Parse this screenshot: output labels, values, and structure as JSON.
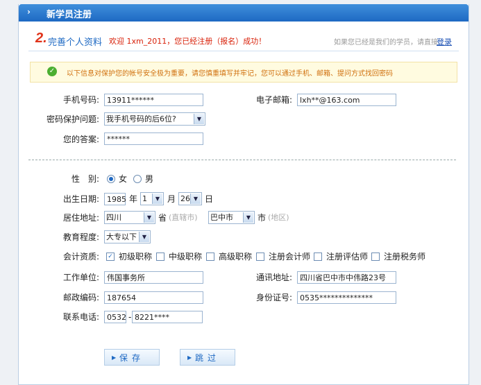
{
  "header": {
    "title": "新学员注册",
    "arrow": "›"
  },
  "step": {
    "number": "2.",
    "label": "完善个人资料"
  },
  "welcome": "欢迎 1xm_2011，您已经注册（报名）成功！",
  "login": {
    "hint": "如果您已经是我们的学员，请直接",
    "link": "登录"
  },
  "notice": "以下信息对保护您的帐号安全极为重要，请您慎重填写并牢记，您可以通过手机、邮箱、提问方式找回密码",
  "security": {
    "phone_label": "手机号码:",
    "phone_value": "13911******",
    "email_label": "电子邮箱:",
    "email_value": "lxh**@163.com",
    "question_label": "密码保护问题:",
    "question_value": "我手机号码的后6位?",
    "answer_label": "您的答案:",
    "answer_value": "******"
  },
  "profile": {
    "gender_label": "性　别:",
    "female": "女",
    "male": "男",
    "birth_label": "出生日期:",
    "year": "1985",
    "year_unit": "年",
    "month": "1",
    "month_unit": "月",
    "day": "26",
    "day_unit": "日",
    "residence_label": "居住地址:",
    "province": "四川",
    "province_unit": "省",
    "province_hint": "(直辖市)",
    "city": "巴中市",
    "city_unit": "市",
    "city_hint": "(地区)",
    "education_label": "教育程度:",
    "education": "大专以下",
    "qual_label": "会计资质:",
    "quals": [
      "初级职称",
      "中级职称",
      "高级职称",
      "注册会计师",
      "注册评估师",
      "注册税务师"
    ],
    "work_label": "工作单位:",
    "work_value": "伟国事务所",
    "address_label": "通讯地址:",
    "address_value": "四川省巴中市中伟路23号",
    "zip_label": "邮政编码:",
    "zip_value": "187654",
    "id_label": "身份证号:",
    "id_value": "0535**************",
    "tel_label": "联系电话:",
    "tel_area": "0532",
    "tel_dash": "-",
    "tel_number": "8221****"
  },
  "buttons": {
    "save": "保存",
    "skip": "跳过"
  }
}
